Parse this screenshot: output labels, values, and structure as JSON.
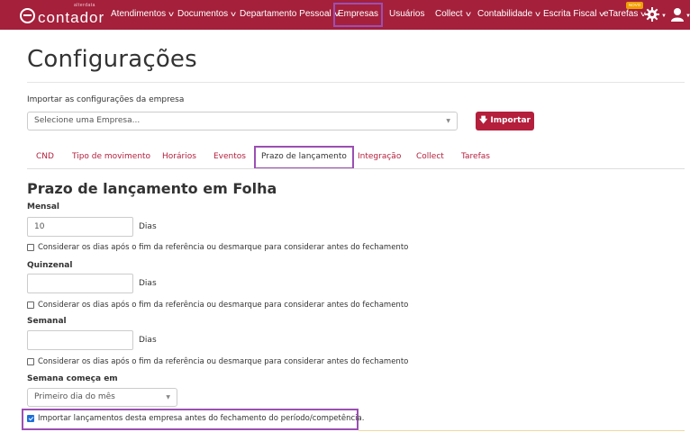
{
  "navbar": {
    "logo_text": "contador",
    "logo_sub": "alterdata",
    "items": [
      {
        "label": "Atendimentos",
        "has_caret": true
      },
      {
        "label": "Documentos",
        "has_caret": true
      },
      {
        "label": "Departamento Pessoal",
        "has_caret": true
      },
      {
        "label": "Empresas",
        "has_caret": false
      },
      {
        "label": "Usuários",
        "has_caret": false
      },
      {
        "label": "Collect",
        "has_caret": true
      },
      {
        "label": "Contabilidade",
        "has_caret": true
      },
      {
        "label": "Escrita Fiscal",
        "has_caret": true
      },
      {
        "label": "eTarefas",
        "has_caret": true
      }
    ],
    "new_badge": "NOVO",
    "colors": {
      "bar": "#a4203b",
      "highlight": "#9b4fb3"
    }
  },
  "page": {
    "title": "Configurações",
    "import_label": "Importar as configurações da empresa",
    "company_select_placeholder": "Selecione uma Empresa...",
    "import_button": "Importar"
  },
  "tabs": [
    {
      "label": "CND"
    },
    {
      "label": "Tipo de movimento"
    },
    {
      "label": "Horários"
    },
    {
      "label": "Eventos"
    },
    {
      "label": "Prazo de lançamento",
      "active": true
    },
    {
      "label": "Integração"
    },
    {
      "label": "Collect"
    },
    {
      "label": "Tarefas"
    }
  ],
  "section": {
    "title": "Prazo de lançamento em Folha",
    "mensal": {
      "label": "Mensal",
      "value": "10",
      "unit": "Dias",
      "check_label": "Considerar os dias após o fim da referência ou desmarque para considerar antes do fechamento",
      "checked": false
    },
    "quinzenal": {
      "label": "Quinzenal",
      "value": "",
      "unit": "Dias",
      "check_label": "Considerar os dias após o fim da referência ou desmarque para considerar antes do fechamento",
      "checked": false
    },
    "semanal": {
      "label": "Semanal",
      "value": "",
      "unit": "Dias",
      "check_label": "Considerar os dias após o fim da referência ou desmarque para considerar antes do fechamento",
      "checked": false
    },
    "semana_comeca": {
      "label": "Semana começa em",
      "selected": "Primeiro dia do mês"
    },
    "import_check": {
      "label": "Importar lançamentos desta empresa antes do fechamento do período/competência.",
      "checked": true
    }
  }
}
